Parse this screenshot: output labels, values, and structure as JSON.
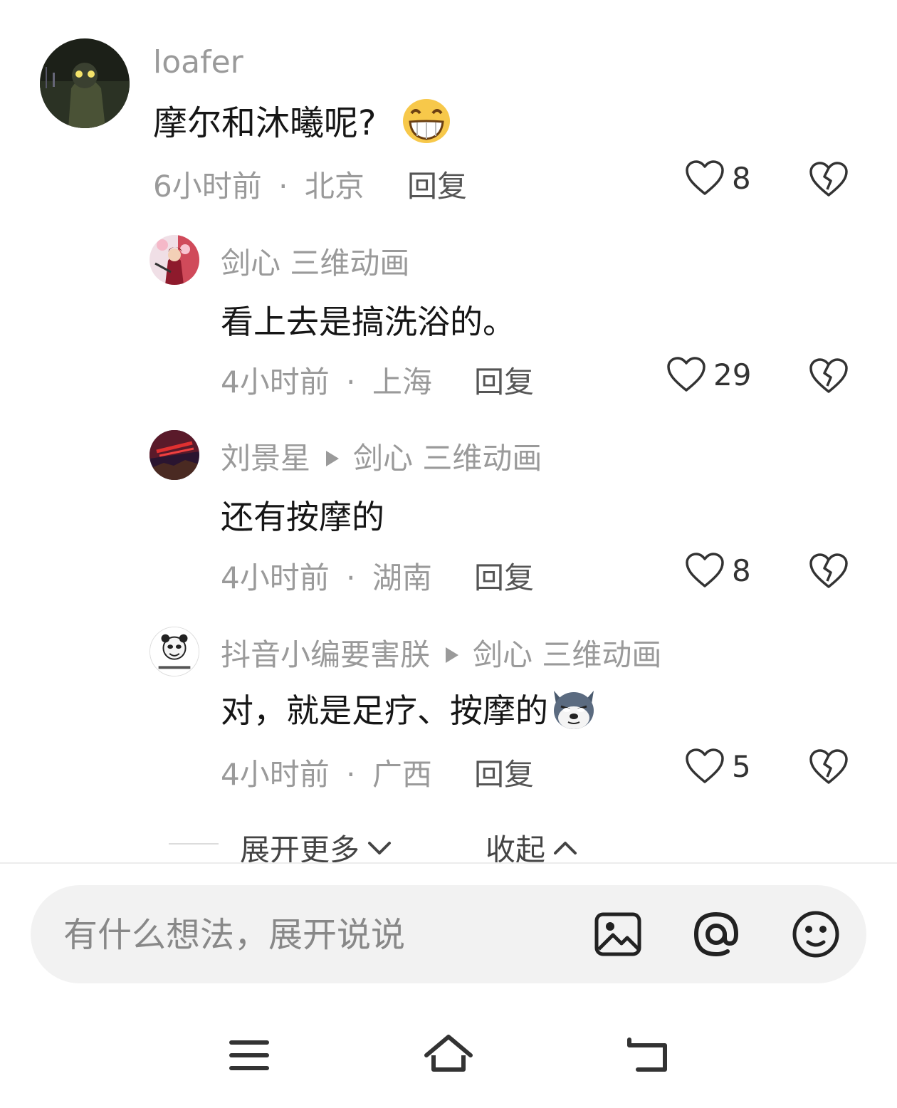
{
  "comments": [
    {
      "username": "loafer",
      "text": "摩尔和沐曦呢?",
      "emoji": "grinning-face-emoji",
      "time": "6小时前",
      "location": "北京",
      "reply_label": "回复",
      "likes": "8"
    },
    {
      "username": "剑心 三维动画",
      "text": "看上去是搞洗浴的。",
      "time": "4小时前",
      "location": "上海",
      "reply_label": "回复",
      "likes": "29"
    },
    {
      "username": "刘景星",
      "reply_to": "剑心 三维动画",
      "text": "还有按摩的",
      "time": "4小时前",
      "location": "湖南",
      "reply_label": "回复",
      "likes": "8"
    },
    {
      "username": "抖音小编要害朕",
      "reply_to": "剑心 三维动画",
      "text": "对，就是足疗、按摩的",
      "emoji": "husky-dog-emoji",
      "time": "4小时前",
      "location": "广西",
      "reply_label": "回复",
      "likes": "5"
    }
  ],
  "meta_separator": "·",
  "expand_more_label": "展开更多",
  "collapse_label": "收起",
  "input": {
    "placeholder": "有什么想法，展开说说",
    "value": ""
  },
  "input_icons": [
    "image-icon",
    "at-icon",
    "emoji-face-icon"
  ],
  "nav_icons": [
    "menu-icon",
    "home-icon",
    "back-icon"
  ],
  "colors": {
    "secondary_text": "#9a9a9a",
    "primary_text": "#161616",
    "input_bg": "#f2f2f2"
  }
}
